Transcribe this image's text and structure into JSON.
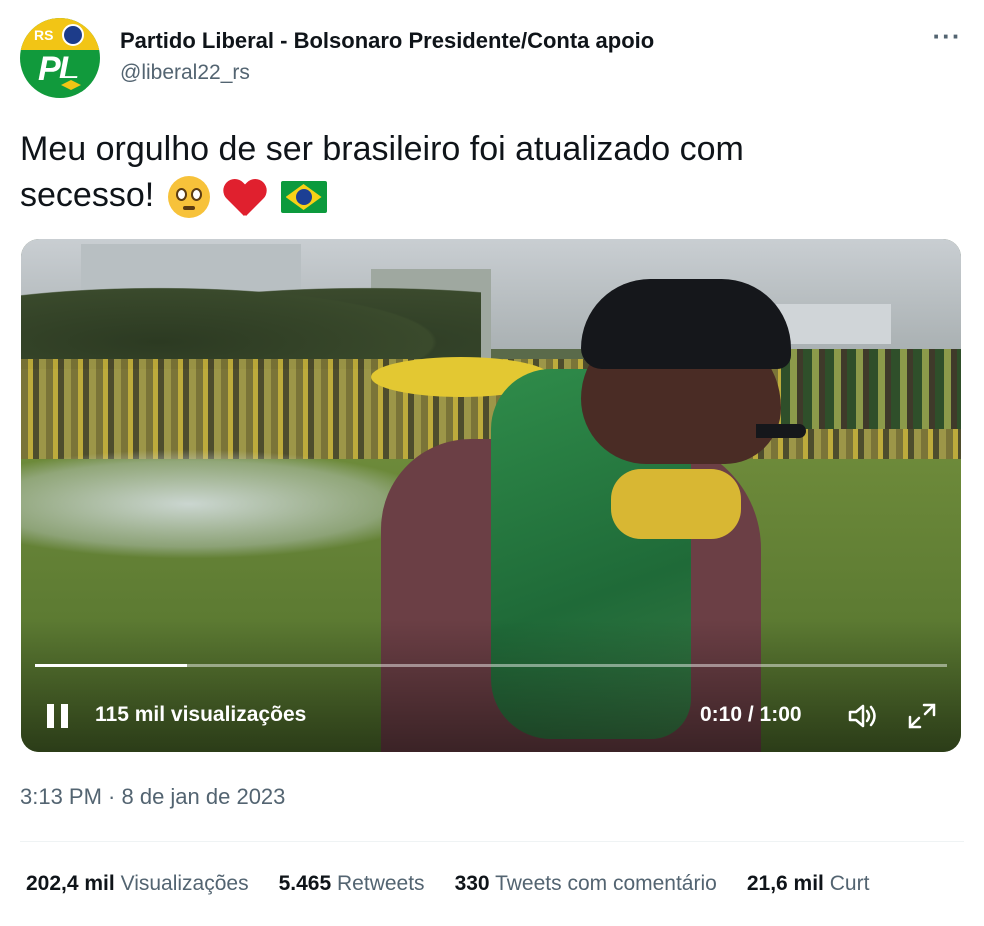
{
  "author": {
    "name": "Partido Liberal - Bolsonaro Presidente/Conta apoio",
    "handle": "@liberal22_rs",
    "avatar": {
      "text_rs": "RS",
      "text_pl": "PL"
    }
  },
  "more_icon": "ellipsis-icon",
  "tweet": {
    "line1": "Meu orgulho de ser brasileiro foi atualizado com",
    "line2": "secesso!",
    "emojis": [
      "pleading-face-icon",
      "red-heart-icon",
      "brazil-flag-icon"
    ]
  },
  "video": {
    "views": "115 mil visualizações",
    "time": "0:10 / 1:00",
    "progress": 0.167,
    "controls": [
      "pause-icon",
      "volume-icon",
      "fullscreen-icon"
    ]
  },
  "timestamp": "3:13 PM · 8 de jan de 2023",
  "stats": [
    {
      "value": "202,4 mil",
      "label": "Visualizações"
    },
    {
      "value": "5.465",
      "label": "Retweets"
    },
    {
      "value": "330",
      "label": "Tweets com comentário"
    },
    {
      "value": "21,6 mil",
      "label": "Curt"
    }
  ],
  "colors": {
    "text": "#0f1419",
    "muted": "#536471",
    "divider": "#eff3f4"
  }
}
